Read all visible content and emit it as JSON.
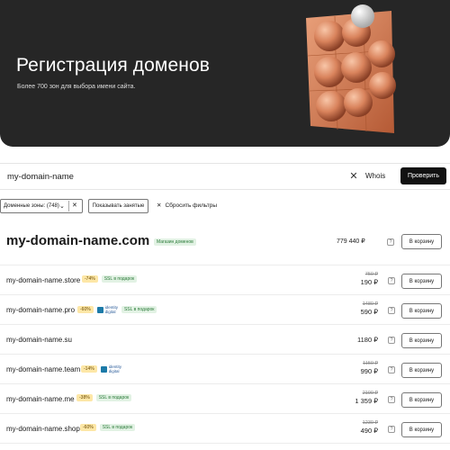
{
  "hero": {
    "title": "Регистрация доменов",
    "subtitle": "Более 700 зон для выбора имени сайта."
  },
  "search": {
    "value": "my-domain-name",
    "clear_icon": "close-icon",
    "whois_label": "Whois",
    "button_label": "Проверить"
  },
  "filters": {
    "zones_label": "Доменные зоны: (748)",
    "show_taken_label": "Показывать занятые",
    "reset_label": "Сбросить фильтры"
  },
  "main_result": {
    "domain": "my-domain-name.com",
    "badge": "Магазин доменов",
    "price": "779 440 ₽",
    "cart_label": "В корзину"
  },
  "results": [
    {
      "domain": "my-domain-name.store",
      "discount": "-74%",
      "badges": [
        "SSL в подарок"
      ],
      "identity": false,
      "old_price": "750 ₽",
      "price": "190 ₽",
      "cart_label": "В корзину"
    },
    {
      "domain": "my-domain-name.pro",
      "discount": "-60%",
      "badges": [
        "SSL в подарок"
      ],
      "identity": true,
      "old_price": "1480 ₽",
      "price": "590 ₽",
      "cart_label": "В корзину"
    },
    {
      "domain": "my-domain-name.su",
      "discount": "",
      "badges": [],
      "identity": false,
      "old_price": "",
      "price": "1180 ₽",
      "cart_label": "В корзину"
    },
    {
      "domain": "my-domain-name.team",
      "discount": "-14%",
      "badges": [],
      "identity": true,
      "old_price": "1150 ₽",
      "price": "990 ₽",
      "cart_label": "В корзину"
    },
    {
      "domain": "my-domain-name.me",
      "discount": "-38%",
      "badges": [
        "SSL в подарок"
      ],
      "identity": false,
      "old_price": "2190 ₽",
      "price": "1 359 ₽",
      "cart_label": "В корзину"
    },
    {
      "domain": "my-domain-name.shop",
      "discount": "-60%",
      "badges": [
        "SSL в подарок"
      ],
      "identity": false,
      "old_price": "1230 ₽",
      "price": "490 ₽",
      "cart_label": "В корзину"
    }
  ],
  "identity_logo": {
    "line1": "identity",
    "line2": "digital"
  },
  "help_icon": "?",
  "colors": {
    "hero_bg": "#262626",
    "copper": "#d9835c",
    "accent_button": "#111111",
    "badge_green_bg": "#e2f2e4",
    "badge_discount_bg": "#fde7a7"
  }
}
